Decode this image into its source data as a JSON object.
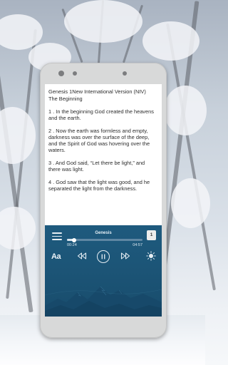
{
  "reader": {
    "heading": "Genesis 1New International Version (NIV)",
    "section": "The Beginning",
    "verses": [
      "1 . In the beginning God created the heavens and the earth.",
      "2 . Now the earth was formless and empty, darkness was over the surface of the deep, and the Spirit of God was hovering over the waters.",
      "3 . And God said, “Let there be light,” and there was light.",
      "4 . God saw that the light was good, and he separated the light from the darkness."
    ]
  },
  "player": {
    "book_title": "Genesis",
    "elapsed": "00:24",
    "total": "04:57",
    "progress": 0.09,
    "chapter": "1",
    "font_button": "Aa",
    "colors": {
      "panel": "#1c5577",
      "icon": "#e6eef4"
    }
  },
  "icons": [
    "menu-icon",
    "font-size-icon",
    "rewind-icon",
    "pause-icon",
    "fast-forward-icon",
    "brightness-icon"
  ]
}
